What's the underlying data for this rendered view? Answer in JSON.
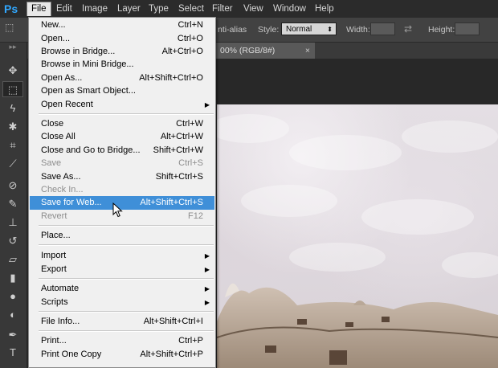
{
  "app": {
    "logo": "Ps"
  },
  "menubar": [
    "File",
    "Edit",
    "Image",
    "Layer",
    "Type",
    "Select",
    "Filter",
    "View",
    "Window",
    "Help"
  ],
  "options": {
    "antialias_label": "nti-alias",
    "style_label": "Style:",
    "style_value": "Normal",
    "width_label": "Width:",
    "height_label": "Height:"
  },
  "document_tab": {
    "title": "00% (RGB/8#)",
    "close": "×"
  },
  "file_menu": {
    "new": {
      "label": "New...",
      "shortcut": "Ctrl+N"
    },
    "open": {
      "label": "Open...",
      "shortcut": "Ctrl+O"
    },
    "browse_bridge": {
      "label": "Browse in Bridge...",
      "shortcut": "Alt+Ctrl+O"
    },
    "browse_mini_bridge": {
      "label": "Browse in Mini Bridge...",
      "shortcut": ""
    },
    "open_as": {
      "label": "Open As...",
      "shortcut": "Alt+Shift+Ctrl+O"
    },
    "open_smart": {
      "label": "Open as Smart Object...",
      "shortcut": ""
    },
    "open_recent": {
      "label": "Open Recent",
      "shortcut": ""
    },
    "close": {
      "label": "Close",
      "shortcut": "Ctrl+W"
    },
    "close_all": {
      "label": "Close All",
      "shortcut": "Alt+Ctrl+W"
    },
    "close_bridge": {
      "label": "Close and Go to Bridge...",
      "shortcut": "Shift+Ctrl+W"
    },
    "save": {
      "label": "Save",
      "shortcut": "Ctrl+S"
    },
    "save_as": {
      "label": "Save As...",
      "shortcut": "Shift+Ctrl+S"
    },
    "check_in": {
      "label": "Check In...",
      "shortcut": ""
    },
    "save_web": {
      "label": "Save for Web...",
      "shortcut": "Alt+Shift+Ctrl+S"
    },
    "revert": {
      "label": "Revert",
      "shortcut": "F12"
    },
    "place": {
      "label": "Place...",
      "shortcut": ""
    },
    "import": {
      "label": "Import",
      "shortcut": ""
    },
    "export": {
      "label": "Export",
      "shortcut": ""
    },
    "automate": {
      "label": "Automate",
      "shortcut": ""
    },
    "scripts": {
      "label": "Scripts",
      "shortcut": ""
    },
    "file_info": {
      "label": "File Info...",
      "shortcut": "Alt+Shift+Ctrl+I"
    },
    "print": {
      "label": "Print...",
      "shortcut": "Ctrl+P"
    },
    "print_one": {
      "label": "Print One Copy",
      "shortcut": "Alt+Shift+Ctrl+P"
    }
  },
  "colors": {
    "menu_highlight": "#3f8fd8",
    "menubar": "#2b2b2b",
    "workspace": "#282828"
  }
}
